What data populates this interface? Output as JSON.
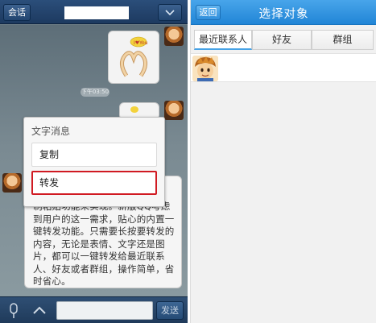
{
  "left_screen": {
    "header": {
      "back_label": "会话",
      "menu_icon": "chevron-down-icon"
    },
    "timestamp": "下午03:50",
    "popup": {
      "title": "文字消息",
      "copy_label": "复制",
      "forward_label": "转发",
      "highlight_color": "#d01a22"
    },
    "message_text": "制粘贴功能来实现。新版QQ考虑到用户的这一需求，贴心的内置一键转发功能。只需要长按要转发的内容，无论是表情、文字还是图片，都可以一键转发给最近联系人、好友或者群组，操作简单，省时省心。",
    "input_bar": {
      "voice_icon": "microphone-icon",
      "expand_icon": "chevron-up-icon",
      "send_label": "发送"
    }
  },
  "right_screen": {
    "header": {
      "back_label": "返回",
      "title": "选择对象",
      "color": "#2b8fdc"
    },
    "tabs": [
      {
        "label": "最近联系人",
        "selected": true
      },
      {
        "label": "好友",
        "selected": false
      },
      {
        "label": "群组",
        "selected": false
      }
    ],
    "contacts": [
      {
        "avatar_icon": "cartoon-boy-avatar"
      }
    ]
  }
}
